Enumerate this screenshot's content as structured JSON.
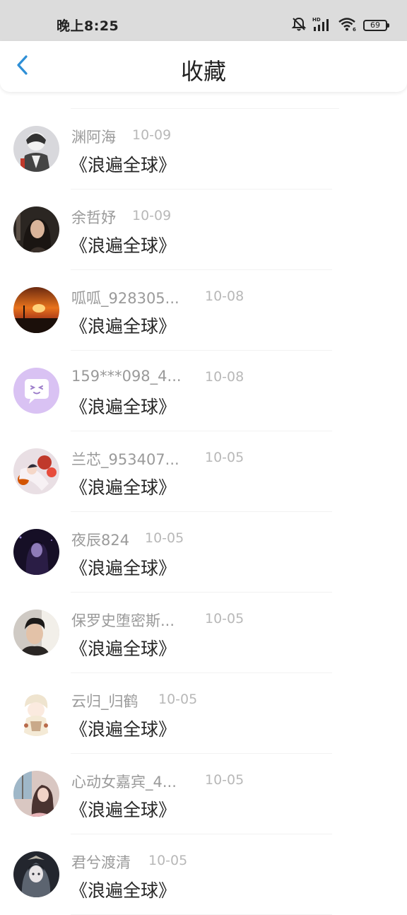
{
  "status_bar": {
    "time": "晚上8:25",
    "battery": "69",
    "icons": [
      "mute-bell-icon",
      "hd-signal-icon",
      "wifi-icon",
      "battery-icon"
    ]
  },
  "header": {
    "title": "收藏",
    "back_icon": "chevron-left-icon",
    "accent_color": "#2e8fd6"
  },
  "items": [
    {
      "name": "渊阿海",
      "date": "10-09",
      "title": "《浪遍全球》",
      "avatar": "anime-boy-avatar"
    },
    {
      "name": "余哲妤",
      "date": "10-09",
      "title": "《浪遍全球》",
      "avatar": "portrait-woman-avatar"
    },
    {
      "name": "呱呱_928305...",
      "date": "10-08",
      "title": "《浪遍全球》",
      "avatar": "sunset-fire-avatar"
    },
    {
      "name": "159***098_4...",
      "date": "10-08",
      "title": "《浪遍全球》",
      "avatar": "default-chat-bubble-avatar"
    },
    {
      "name": "兰芯_953407...",
      "date": "10-05",
      "title": "《浪遍全球》",
      "avatar": "anime-girl-flowers-avatar"
    },
    {
      "name": "夜辰824",
      "date": "10-05",
      "title": "《浪遍全球》",
      "avatar": "dark-purple-avatar"
    },
    {
      "name": "保罗史堕密斯...",
      "date": "10-05",
      "title": "《浪遍全球》",
      "avatar": "man-portrait-avatar"
    },
    {
      "name": "云归_归鹤",
      "date": "10-05",
      "title": "《浪遍全球》",
      "avatar": "anime-chibi-avatar"
    },
    {
      "name": "心动女嘉宾_4...",
      "date": "10-05",
      "title": "《浪遍全球》",
      "avatar": "woman-window-avatar"
    },
    {
      "name": "君兮渡清",
      "date": "10-05",
      "title": "《浪遍全球》",
      "avatar": "gothic-girl-avatar"
    }
  ]
}
